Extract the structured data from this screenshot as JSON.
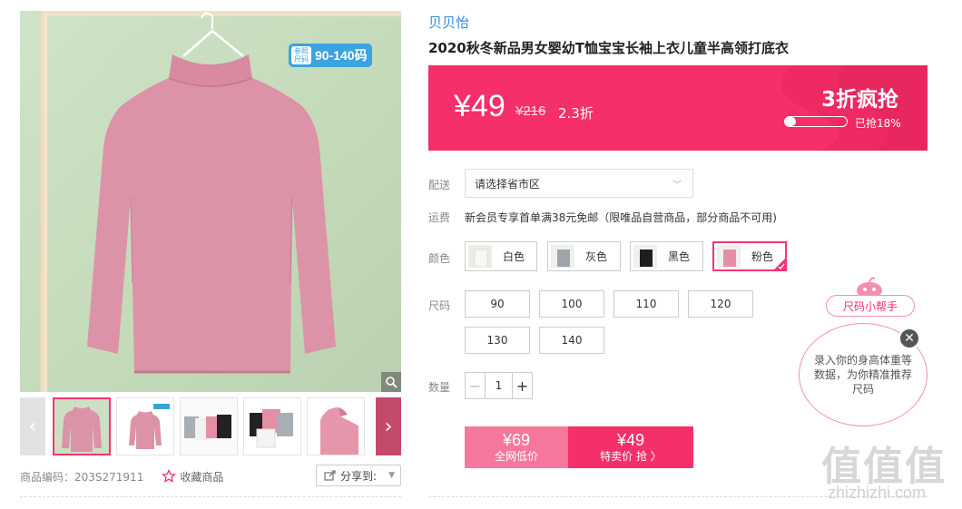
{
  "product": {
    "brand": "贝贝怡",
    "title": "2020秋冬新品男女婴幼T恤宝宝长袖上衣儿童半高领打底衣",
    "size_badge_tag": "参照尺码",
    "size_badge_range": "90-140码",
    "code_text": "商品编码：203S271911",
    "favorite_label": "收藏商品",
    "share_label": "分享到:"
  },
  "price": {
    "current": "¥49",
    "original": "¥216",
    "discount": "2.3折",
    "promo_title": "3折疯抢",
    "sold_text": "已抢18%",
    "sold_fraction": 0.18
  },
  "delivery": {
    "label": "配送",
    "placeholder": "请选择省市区"
  },
  "shipping": {
    "label": "运费",
    "text": "新会员专享首单满38元免邮（限唯品自营商品，部分商品不可用)"
  },
  "colors": {
    "label": "颜色",
    "options": [
      {
        "name": "白色",
        "swatch": "#f4f4f2"
      },
      {
        "name": "灰色",
        "swatch": "#9ea4aa"
      },
      {
        "name": "黑色",
        "swatch": "#1e1e1e"
      },
      {
        "name": "粉色",
        "swatch": "#e58fa5"
      }
    ],
    "selected": "粉色"
  },
  "sizes": {
    "label": "尺码",
    "options": [
      "90",
      "100",
      "110",
      "120",
      "130",
      "140"
    ]
  },
  "quantity": {
    "label": "数量",
    "value": "1",
    "minus": "−",
    "plus": "+"
  },
  "buy": {
    "market_price": "¥69",
    "market_label": "全网低价",
    "sale_price": "¥49",
    "sale_label": "特卖价 抢 〉"
  },
  "helper": {
    "title": "尺码小帮手",
    "text": "录入你的身高体重等数据，为你精准推荐尺码",
    "close": "✕"
  },
  "gallery": {
    "prev": "‹",
    "next": "›"
  },
  "watermark": {
    "logo": "值值值",
    "site": "zhizhizhi.com"
  },
  "colors_theme": {
    "accent": "#f42f6a",
    "brand_link": "#2f8de4"
  }
}
